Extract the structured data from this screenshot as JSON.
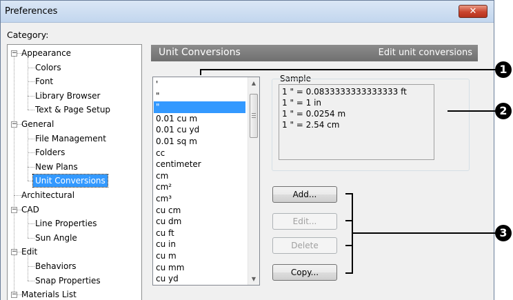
{
  "window": {
    "title": "Preferences",
    "close_glyph": "✕"
  },
  "category_label": "Category:",
  "tree": [
    {
      "label": "Appearance",
      "level": 0,
      "expander": "−"
    },
    {
      "label": "Colors",
      "level": 1
    },
    {
      "label": "Font",
      "level": 1
    },
    {
      "label": "Library Browser",
      "level": 1
    },
    {
      "label": "Text & Page Setup",
      "level": 1
    },
    {
      "label": "General",
      "level": 0,
      "expander": "−"
    },
    {
      "label": "File Management",
      "level": 1
    },
    {
      "label": "Folders",
      "level": 1
    },
    {
      "label": "New Plans",
      "level": 1
    },
    {
      "label": "Unit Conversions",
      "level": 1,
      "selected": true
    },
    {
      "label": "Architectural",
      "level": 0
    },
    {
      "label": "CAD",
      "level": 0,
      "expander": "−"
    },
    {
      "label": "Line Properties",
      "level": 1
    },
    {
      "label": "Sun Angle",
      "level": 1
    },
    {
      "label": "Edit",
      "level": 0,
      "expander": "−"
    },
    {
      "label": "Behaviors",
      "level": 1
    },
    {
      "label": "Snap Properties",
      "level": 1
    },
    {
      "label": "Materials List",
      "level": 0,
      "expander": "−"
    }
  ],
  "header": {
    "title": "Unit Conversions",
    "subtitle": "Edit unit conversions"
  },
  "unit_list": {
    "items": [
      "'",
      "\"",
      "\"",
      "0.01 cu m",
      "0.01 cu yd",
      "0.01 sq m",
      "cc",
      "centimeter",
      "cm",
      "cm²",
      "cm³",
      "cu cm",
      "cu dm",
      "cu ft",
      "cu in",
      "cu m",
      "cu mm",
      "cu yd"
    ],
    "selected_index": 2,
    "scroll_up": "▲",
    "scroll_down": "▼"
  },
  "sample": {
    "label": "Sample",
    "lines": [
      "1 \" = 0.0833333333333333 ft",
      "1 \" = 1 in",
      "1 \" = 0.0254 m",
      "1 \" = 2.54 cm"
    ]
  },
  "buttons": [
    {
      "label": "Add...",
      "enabled": true
    },
    {
      "label": "Edit...",
      "enabled": false
    },
    {
      "label": "Delete",
      "enabled": false
    },
    {
      "label": "Copy...",
      "enabled": true
    }
  ],
  "callouts": [
    "1",
    "2",
    "3"
  ]
}
